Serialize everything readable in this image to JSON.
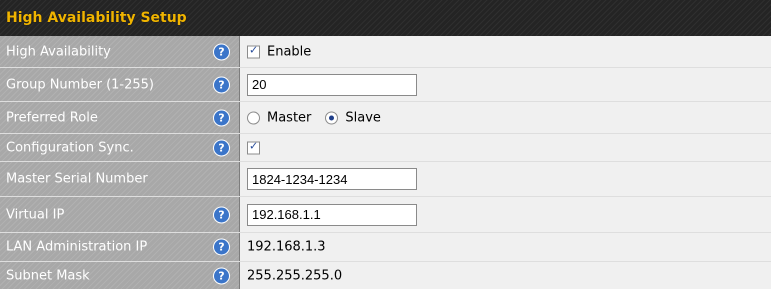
{
  "title": "High Availability Setup",
  "colors": {
    "title": "#f0b400",
    "label_bg": "#a8a8a8",
    "value_bg": "#f0f0f0",
    "help_icon": "#3b75c9",
    "title_bar": "#242424"
  },
  "icons": {
    "help": "question-mark-circle",
    "help_glyph": "?"
  },
  "rows": {
    "high_availability": {
      "label": "High Availability",
      "checkbox_checked": true,
      "checkbox_label": "Enable"
    },
    "group_number": {
      "label": "Group Number (1-255)",
      "value": "20"
    },
    "preferred_role": {
      "label": "Preferred Role",
      "options": [
        "Master",
        "Slave"
      ],
      "selected": "Slave"
    },
    "config_sync": {
      "label": "Configuration Sync.",
      "checkbox_checked": true
    },
    "master_serial": {
      "label": "Master Serial Number",
      "value": "1824-1234-1234"
    },
    "virtual_ip": {
      "label": "Virtual IP",
      "value": "192.168.1.1"
    },
    "lan_admin_ip": {
      "label": "LAN Administration IP",
      "value": "192.168.1.3"
    },
    "subnet_mask": {
      "label": "Subnet Mask",
      "value": "255.255.255.0"
    }
  }
}
